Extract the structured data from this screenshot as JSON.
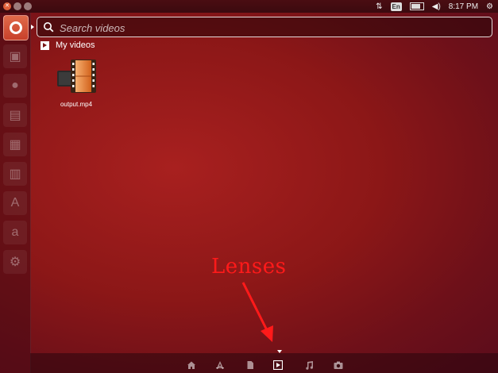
{
  "top_panel": {
    "keyboard_layout": "En",
    "clock": "8:17 PM"
  },
  "search": {
    "placeholder": "Search videos",
    "value": ""
  },
  "results": {
    "category_title": "My videos",
    "items": [
      {
        "label": "output.mp4",
        "icon": "video-file-icon"
      }
    ]
  },
  "annotation": {
    "text": "Lenses",
    "color": "#ff1a1a"
  },
  "lens_bar": {
    "lenses": [
      {
        "name": "home",
        "icon": "home-icon"
      },
      {
        "name": "applications",
        "icon": "applications-icon"
      },
      {
        "name": "files",
        "icon": "files-icon"
      },
      {
        "name": "videos",
        "icon": "video-icon",
        "active": true
      },
      {
        "name": "music",
        "icon": "music-icon"
      },
      {
        "name": "photos",
        "icon": "camera-icon"
      }
    ]
  },
  "colors": {
    "accent": "#e06a4a",
    "background": "#8c1717",
    "annotation": "#ff1a1a"
  }
}
